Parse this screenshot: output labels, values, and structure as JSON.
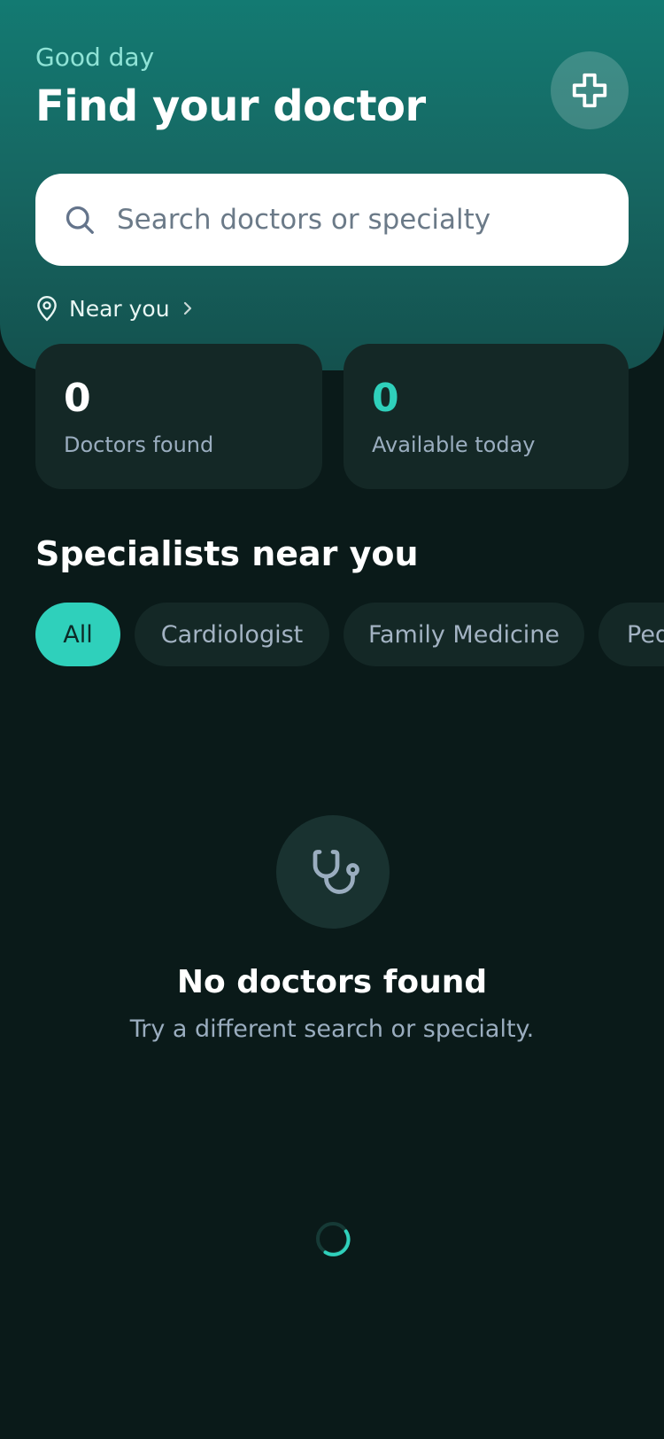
{
  "header": {
    "greeting": "Good day",
    "title": "Find your doctor",
    "action_icon": "plus-icon"
  },
  "search": {
    "placeholder": "Search doctors or specialty",
    "value": ""
  },
  "location": {
    "label": "Near you"
  },
  "stats": [
    {
      "value": "0",
      "label": "Doctors found"
    },
    {
      "value": "0",
      "label": "Available today"
    }
  ],
  "specialists": {
    "title": "Specialists near you",
    "chips": [
      "All",
      "Cardiologist",
      "Family Medicine",
      "Pediatrics"
    ],
    "selected": "All"
  },
  "empty_state": {
    "icon": "stethoscope-icon",
    "title": "No doctors found",
    "subtitle": "Try a different search or specialty."
  },
  "colors": {
    "accent": "#2fd0bb",
    "background": "#0a1a19",
    "card": "#142826",
    "header": "#137a72"
  }
}
